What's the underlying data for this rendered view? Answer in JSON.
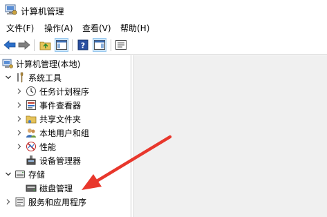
{
  "window": {
    "title": "计算机管理"
  },
  "menu": [
    "文件(F)",
    "操作(A)",
    "查看(V)",
    "帮助(H)"
  ],
  "toolbar": {
    "buttons": [
      "back-icon",
      "forward-icon",
      "up-folder-icon",
      "show-tree-icon",
      "help-icon",
      "show-pane-icon",
      "properties-icon"
    ]
  },
  "tree": {
    "root": "计算机管理(本地)",
    "system_tools": "系统工具",
    "task_scheduler": "任务计划程序",
    "event_viewer": "事件查看器",
    "shared_folders": "共享文件夹",
    "local_users": "本地用户和组",
    "performance": "性能",
    "device_manager": "设备管理器",
    "storage": "存储",
    "disk_management": "磁盘管理",
    "services_apps": "服务和应用程序"
  },
  "colors": {
    "arrow": "#e8372c",
    "pane_bg": "#f0f0f0",
    "toolbar_blue": "#2b6fc9"
  }
}
